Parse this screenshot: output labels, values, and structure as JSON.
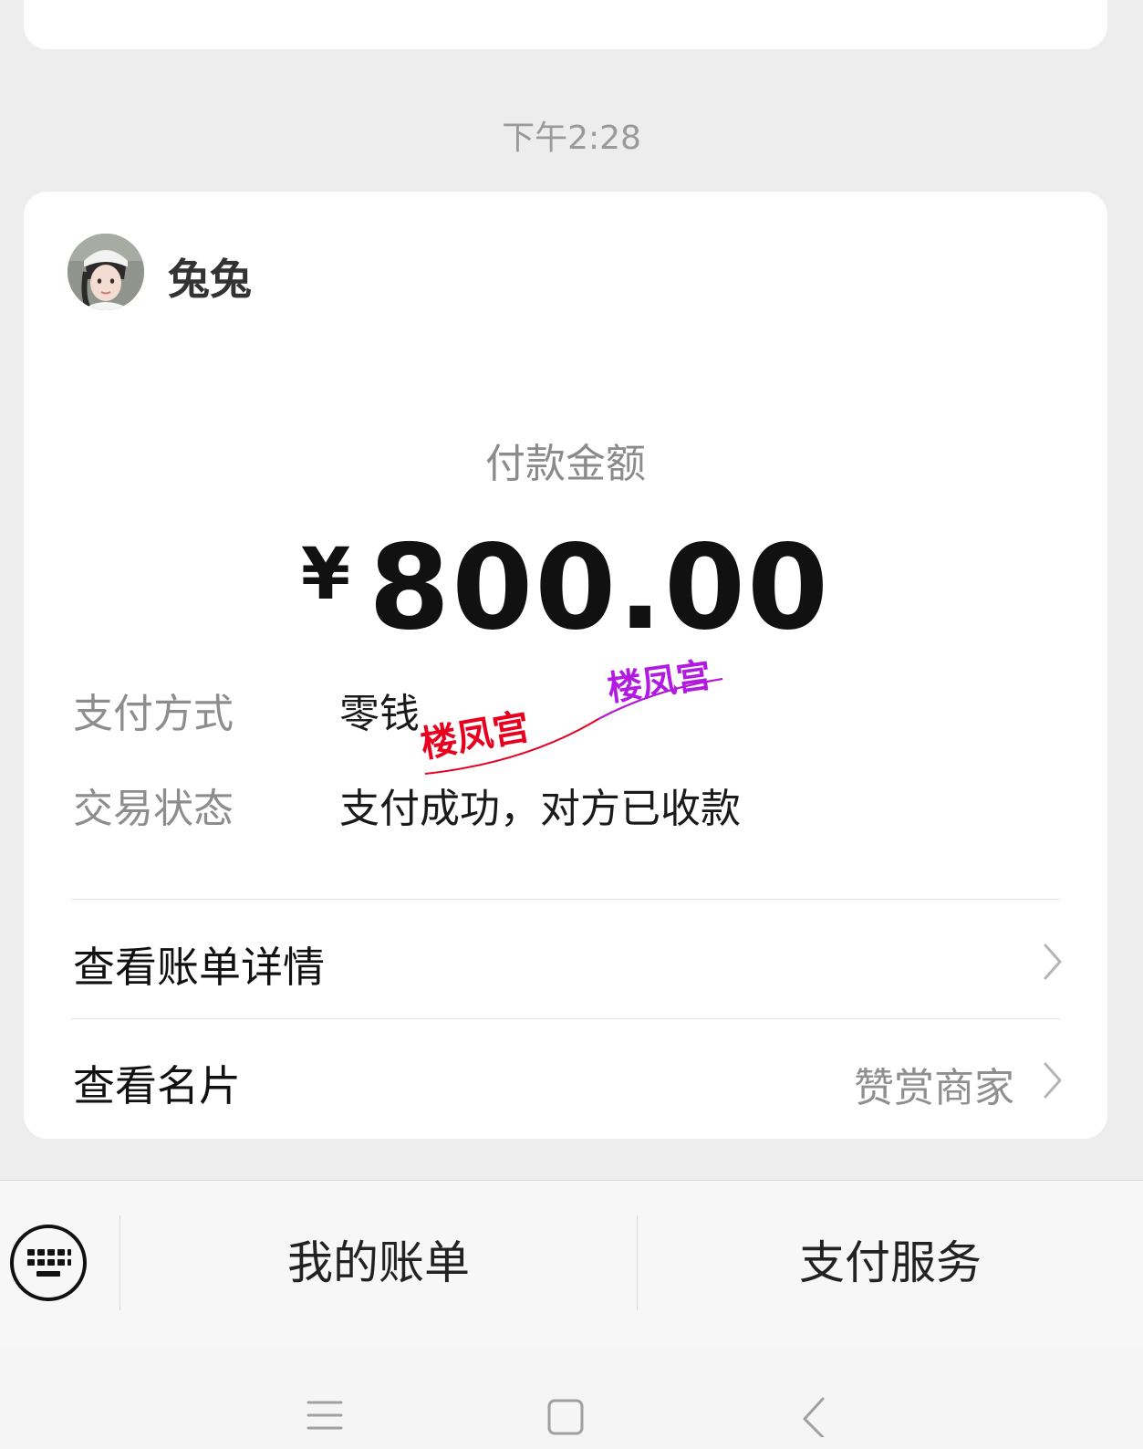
{
  "timestamp": "下午2:28",
  "payment": {
    "sender_name": "兔兔",
    "amount_label": "付款金额",
    "currency_symbol": "¥",
    "amount": "800.00",
    "method_label": "支付方式",
    "method_value": "零钱",
    "status_label": "交易状态",
    "status_value": "支付成功，对方已收款"
  },
  "watermark": {
    "text_1": "楼凤宫",
    "text_2": "楼凤宫"
  },
  "links": {
    "bill_details": "查看账单详情",
    "view_card": "查看名片",
    "reward_merchant": "赞赏商家"
  },
  "toolbar": {
    "my_bills": "我的账单",
    "payment_services": "支付服务"
  },
  "icons": {
    "keyboard": "keyboard-icon",
    "chevron": "chevron-right-icon",
    "menu": "menu-icon",
    "home": "home-icon",
    "back": "back-icon"
  },
  "colors": {
    "background": "#ededed",
    "card": "#ffffff",
    "watermark_red": "#e8001f",
    "watermark_purple": "#b11adf"
  }
}
